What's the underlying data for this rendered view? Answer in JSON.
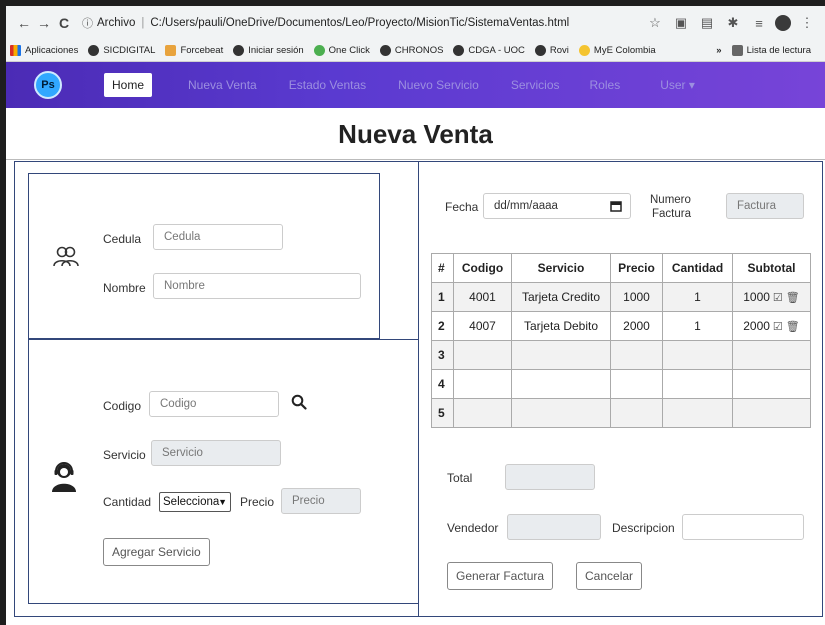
{
  "browser": {
    "nav": {
      "back": "←",
      "forward": "→",
      "reload": "C"
    },
    "url_label": "Archivo",
    "url": "C:/Users/pauli/OneDrive/Documentos/Leo/Proyecto/MisionTic/SistemaVentas.html",
    "toolbar_icons": [
      "star-icon",
      "reading-icon",
      "extension-icon",
      "pin-icon",
      "playlist-icon",
      "profile-icon",
      "menu-icon"
    ]
  },
  "bookmarks": {
    "items": [
      "Aplicaciones",
      "SICDIGITAL",
      "Forcebeat",
      "Iniciar sesión",
      "One Click",
      "CHRONOS",
      "CDGA - UOC",
      "Rovi",
      "MyE Colombia"
    ],
    "overflow": "»",
    "reading_list": "Lista de lectura"
  },
  "navbar": {
    "logo": "Ps",
    "links": [
      "Home",
      "Nueva Venta",
      "Estado Ventas",
      "Nuevo Servicio",
      "Servicios",
      "Roles",
      "User ▾"
    ]
  },
  "page": {
    "title": "Nueva Venta"
  },
  "client": {
    "cedula_label": "Cedula",
    "cedula_placeholder": "Cedula",
    "nombre_label": "Nombre",
    "nombre_placeholder": "Nombre"
  },
  "service": {
    "codigo_label": "Codigo",
    "codigo_placeholder": "Codigo",
    "servicio_label": "Servicio",
    "servicio_placeholder": "Servicio",
    "cantidad_label": "Cantidad",
    "cantidad_selected": "Selecciona",
    "precio_label": "Precio",
    "precio_placeholder": "Precio",
    "add_button": "Agregar Servicio"
  },
  "invoice": {
    "fecha_label": "Fecha",
    "fecha_placeholder": "dd/mm/aaaa",
    "numero_label_1": "Numero",
    "numero_label_2": "Factura",
    "factura_placeholder": "Factura",
    "columns": [
      "#",
      "Codigo",
      "Servicio",
      "Precio",
      "Cantidad",
      "Subtotal"
    ],
    "rows": [
      {
        "n": "1",
        "codigo": "4001",
        "servicio": "Tarjeta Credito",
        "precio": "1000",
        "cantidad": "1",
        "subtotal": "1000"
      },
      {
        "n": "2",
        "codigo": "4007",
        "servicio": "Tarjeta Debito",
        "precio": "2000",
        "cantidad": "1",
        "subtotal": "2000"
      },
      {
        "n": "3",
        "codigo": "",
        "servicio": "",
        "precio": "",
        "cantidad": "",
        "subtotal": ""
      },
      {
        "n": "4",
        "codigo": "",
        "servicio": "",
        "precio": "",
        "cantidad": "",
        "subtotal": ""
      },
      {
        "n": "5",
        "codigo": "",
        "servicio": "",
        "precio": "",
        "cantidad": "",
        "subtotal": ""
      }
    ],
    "total_label": "Total",
    "vendedor_label": "Vendedor",
    "descripcion_label": "Descripcion",
    "generate_button": "Generar Factura",
    "cancel_button": "Cancelar"
  }
}
